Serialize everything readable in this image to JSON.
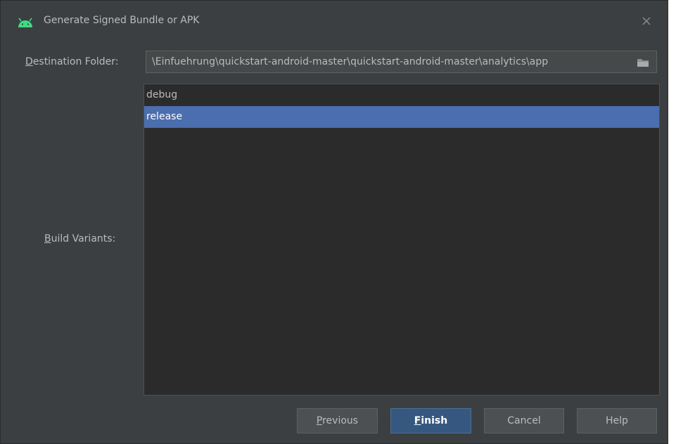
{
  "window": {
    "title": "Generate Signed Bundle or APK",
    "icon": "android-icon",
    "close_icon": "close-icon"
  },
  "destination": {
    "label_mnemonic": "D",
    "label_rest": "estination Folder:",
    "value": "\\Einfuehrung\\quickstart-android-master\\quickstart-android-master\\analytics\\app",
    "icon": "folder-icon"
  },
  "build_variants": {
    "label_mnemonic": "B",
    "label_rest": "uild Variants:",
    "items": [
      {
        "label": "debug",
        "selected": false
      },
      {
        "label": "release",
        "selected": true
      }
    ]
  },
  "buttons": {
    "previous": {
      "mnemonic": "P",
      "rest": "revious"
    },
    "finish": {
      "mnemonic": "F",
      "rest": "inish"
    },
    "cancel": {
      "label": "Cancel"
    },
    "help": {
      "label": "Help"
    }
  },
  "colors": {
    "background": "#3c3f41",
    "list_background": "#2b2b2b",
    "selection": "#4b6eaf",
    "primary_button": "#365880",
    "android_green": "#3ddc84"
  }
}
